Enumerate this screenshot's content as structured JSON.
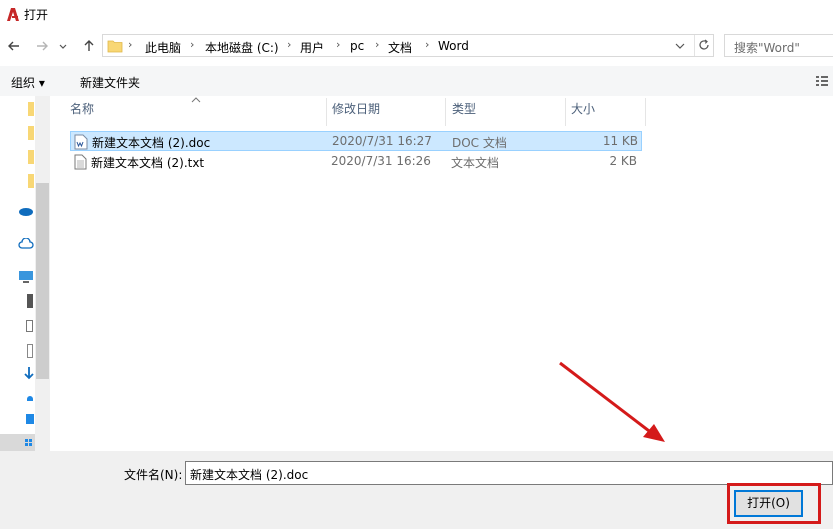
{
  "window": {
    "title": "打开"
  },
  "address": {
    "back_icon": "arrow-left-icon",
    "forward_icon": "arrow-right-icon",
    "up_icon": "arrow-up-icon",
    "crumbs": [
      "此电脑",
      "本地磁盘 (C:)",
      "用户",
      "pc",
      "文档",
      "Word"
    ],
    "search_placeholder": "搜索\"Word\""
  },
  "toolbar": {
    "organize_label": "组织 ▾",
    "new_folder_label": "新建文件夹"
  },
  "columns": {
    "name": "名称",
    "date": "修改日期",
    "type": "类型",
    "size": "大小"
  },
  "files": [
    {
      "name": "新建文本文档 (2).doc",
      "date": "2020/7/31 16:27",
      "type": "DOC 文档",
      "size": "11 KB",
      "selected": true,
      "icon": "word-doc-icon"
    },
    {
      "name": "新建文本文档 (2).txt",
      "date": "2020/7/31 16:26",
      "type": "文本文档",
      "size": "2 KB",
      "selected": false,
      "icon": "text-file-icon"
    }
  ],
  "footer": {
    "filename_label": "文件名(N):",
    "filename_value": "新建文本文档 (2).doc",
    "open_label": "打开(O)"
  },
  "colors": {
    "accent": "#0078d7",
    "selection": "#cce8ff",
    "annotation": "#d41a1a"
  }
}
